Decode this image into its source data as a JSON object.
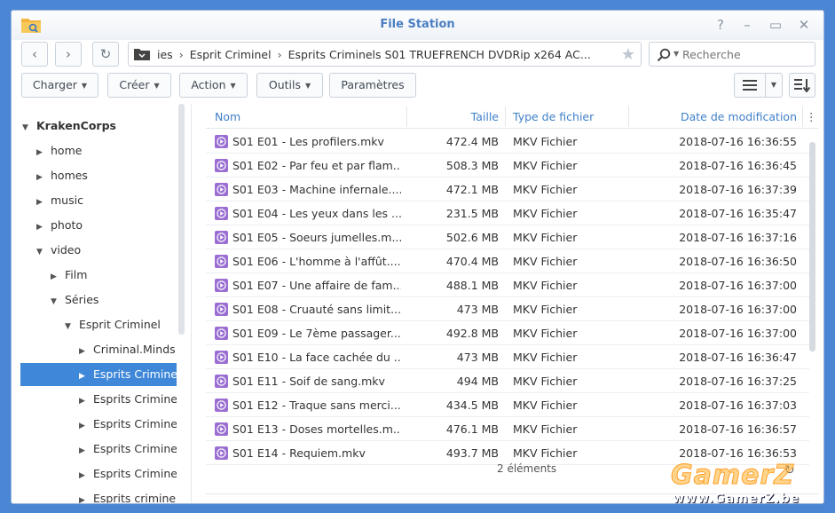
{
  "window": {
    "title": "File Station",
    "controls": [
      "?",
      "–",
      "▭",
      "✕"
    ]
  },
  "nav": {
    "back": "‹",
    "forward": "›",
    "refresh": "↻",
    "path": [
      "ies",
      "Esprit Criminel",
      "Esprits Criminels S01 TRUEFRENCH DVDRip x264 AC..."
    ],
    "search_placeholder": "Recherche"
  },
  "toolbar": {
    "upload": "Charger",
    "create": "Créer",
    "action": "Action",
    "tools": "Outils",
    "settings": "Paramètres"
  },
  "tree": [
    {
      "label": "KrakenCorps",
      "level": 0,
      "arrow": "▼",
      "root": true
    },
    {
      "label": "home",
      "level": 1,
      "arrow": "▶"
    },
    {
      "label": "homes",
      "level": 1,
      "arrow": "▶"
    },
    {
      "label": "music",
      "level": 1,
      "arrow": "▶"
    },
    {
      "label": "photo",
      "level": 1,
      "arrow": "▶"
    },
    {
      "label": "video",
      "level": 1,
      "arrow": "▼"
    },
    {
      "label": "Film",
      "level": 2,
      "arrow": "▶"
    },
    {
      "label": "Séries",
      "level": 2,
      "arrow": "▼"
    },
    {
      "label": "Esprit Criminel",
      "level": 3,
      "arrow": "▼"
    },
    {
      "label": "Criminal.Minds.",
      "level": 4,
      "arrow": "▶"
    },
    {
      "label": "Esprits Criminel",
      "level": 4,
      "arrow": "▶",
      "selected": true
    },
    {
      "label": "Esprits Criminel",
      "level": 4,
      "arrow": "▶"
    },
    {
      "label": "Esprits Criminel",
      "level": 4,
      "arrow": "▶"
    },
    {
      "label": "Esprits Criminel",
      "level": 4,
      "arrow": "▶"
    },
    {
      "label": "Esprits Criminel",
      "level": 4,
      "arrow": "▶"
    },
    {
      "label": "Esprits criminel",
      "level": 4,
      "arrow": "▶"
    }
  ],
  "columns": {
    "name": "Nom",
    "size": "Taille",
    "type": "Type de fichier",
    "modified": "Date de modification"
  },
  "files": [
    {
      "name": "S01 E01 - Les profilers.mkv",
      "size": "472.4 MB",
      "type": "MKV Fichier",
      "modified": "2018-07-16 16:36:55"
    },
    {
      "name": "S01 E02 - Par feu et par flam...",
      "size": "508.3 MB",
      "type": "MKV Fichier",
      "modified": "2018-07-16 16:36:45"
    },
    {
      "name": "S01 E03 - Machine infernale....",
      "size": "472.1 MB",
      "type": "MKV Fichier",
      "modified": "2018-07-16 16:37:39"
    },
    {
      "name": "S01 E04 - Les yeux dans les ...",
      "size": "231.5 MB",
      "type": "MKV Fichier",
      "modified": "2018-07-16 16:35:47"
    },
    {
      "name": "S01 E05 - Soeurs jumelles.m...",
      "size": "502.6 MB",
      "type": "MKV Fichier",
      "modified": "2018-07-16 16:37:16"
    },
    {
      "name": "S01 E06 - L'homme à l'affût....",
      "size": "470.4 MB",
      "type": "MKV Fichier",
      "modified": "2018-07-16 16:36:50"
    },
    {
      "name": "S01 E07 - Une affaire de fam...",
      "size": "488.1 MB",
      "type": "MKV Fichier",
      "modified": "2018-07-16 16:37:00"
    },
    {
      "name": "S01 E08 - Cruauté sans limit...",
      "size": "473 MB",
      "type": "MKV Fichier",
      "modified": "2018-07-16 16:37:00"
    },
    {
      "name": "S01 E09 - Le 7ème passager....",
      "size": "492.8 MB",
      "type": "MKV Fichier",
      "modified": "2018-07-16 16:37:00"
    },
    {
      "name": "S01 E10 - La face cachée du ...",
      "size": "473 MB",
      "type": "MKV Fichier",
      "modified": "2018-07-16 16:36:47"
    },
    {
      "name": "S01 E11 - Soif de sang.mkv",
      "size": "494 MB",
      "type": "MKV Fichier",
      "modified": "2018-07-16 16:37:25"
    },
    {
      "name": "S01 E12 - Traque sans merci...",
      "size": "434.5 MB",
      "type": "MKV Fichier",
      "modified": "2018-07-16 16:37:03"
    },
    {
      "name": "S01 E13 - Doses mortelles.m...",
      "size": "476.1 MB",
      "type": "MKV Fichier",
      "modified": "2018-07-16 16:36:57"
    },
    {
      "name": "S01 E14 - Requiem.mkv",
      "size": "493.7 MB",
      "type": "MKV Fichier",
      "modified": "2018-07-16 16:36:53"
    }
  ],
  "footer": {
    "count": "2 éléments"
  },
  "watermark": {
    "big": "GamerZ",
    "small": "www.GamerZ.be"
  },
  "colors": {
    "accent": "#3f87d8",
    "header_text": "#3f7fc8",
    "mkv_icon": "#9a6fd1"
  }
}
